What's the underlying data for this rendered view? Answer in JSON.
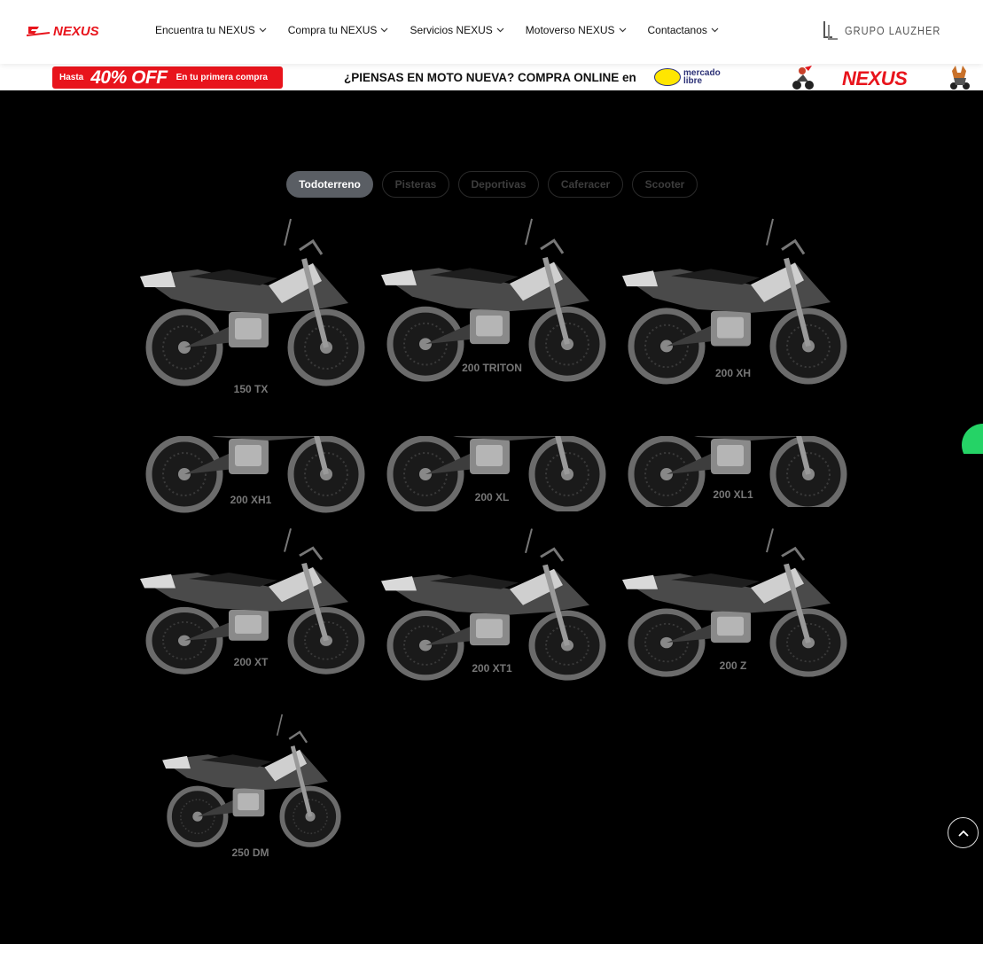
{
  "header": {
    "logo_icon": "nexus-logo",
    "nav": [
      {
        "label": "Encuentra tu NEXUS"
      },
      {
        "label": "Compra tu NEXUS"
      },
      {
        "label": "Servicios NEXUS"
      },
      {
        "label": "Motoverso NEXUS"
      },
      {
        "label": "Contactanos"
      }
    ],
    "partner_brand": "GRUPO LAUZHER"
  },
  "banner": {
    "promo_prefix": "Hasta",
    "promo_discount": "40% OFF",
    "promo_suffix": "En tu primera compra",
    "headline": "¿PIENSAS EN MOTO NUEVA? COMPRA ONLINE en",
    "marketplace_line1": "mercado",
    "marketplace_line2": "libre",
    "brand": "NEXUS"
  },
  "tabs": [
    {
      "label": "Todoterreno",
      "active": true
    },
    {
      "label": "Pisteras",
      "active": false
    },
    {
      "label": "Deportivas",
      "active": false
    },
    {
      "label": "Caferacer",
      "active": false
    },
    {
      "label": "Scooter",
      "active": false
    }
  ],
  "motorcycles": [
    {
      "name": "150 TX"
    },
    {
      "name": "200 TRITON"
    },
    {
      "name": "200 XH"
    },
    {
      "name": "200 XH1"
    },
    {
      "name": "200 XL"
    },
    {
      "name": "200 XL1"
    },
    {
      "name": "200 XT"
    },
    {
      "name": "200 XT1"
    },
    {
      "name": "200 Z"
    },
    {
      "name": "250 DM"
    }
  ],
  "colors": {
    "brand_red": "#e8141c",
    "section_bg": "#000000",
    "active_tab": "#5a5e64",
    "whatsapp": "#25d366"
  }
}
